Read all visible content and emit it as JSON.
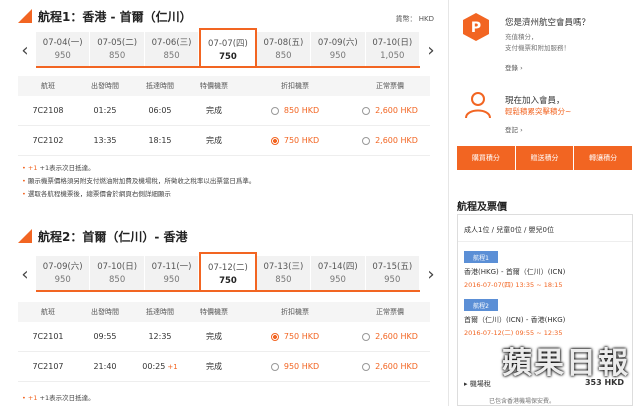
{
  "currency_label": "貨幣： HKD",
  "segments": [
    {
      "title": "航程1：香港 - 首爾（仁川）",
      "dates": [
        {
          "date": "07-04(一)",
          "price": "950"
        },
        {
          "date": "07-05(二)",
          "price": "850"
        },
        {
          "date": "07-06(三)",
          "price": "850"
        },
        {
          "date": "07-07(四)",
          "price": "750",
          "selected": true
        },
        {
          "date": "07-08(五)",
          "price": "850"
        },
        {
          "date": "07-09(六)",
          "price": "950"
        },
        {
          "date": "07-10(日)",
          "price": "1,050"
        }
      ],
      "headers": [
        "航班",
        "出發時間",
        "抵達時間",
        "特價機票",
        "折扣機票",
        "正常票價"
      ],
      "flights": [
        {
          "flight": "7C2108",
          "dep": "01:25",
          "arr": "06:05",
          "plus": "",
          "special": "完成",
          "discount": "850 HKD",
          "normal": "2,600 HKD",
          "discount_selected": false
        },
        {
          "flight": "7C2102",
          "dep": "13:35",
          "arr": "18:15",
          "plus": "",
          "special": "完成",
          "discount": "750 HKD",
          "normal": "2,600 HKD",
          "discount_selected": true
        }
      ],
      "notes": [
        {
          "bullet": "• +1",
          "text": " +1表示次日抵達。"
        },
        {
          "bullet": "•",
          "text": " 顯示機票價格須另附支付燃油附加費及機場稅，所徵收之稅率以出票當日爲準。"
        },
        {
          "bullet": "•",
          "text": " 選取各航程機票後，總票價會於網頁右側詳細顯示"
        }
      ]
    },
    {
      "title": "航程2：首爾（仁川）- 香港",
      "dates": [
        {
          "date": "07-09(六)",
          "price": "950"
        },
        {
          "date": "07-10(日)",
          "price": "850"
        },
        {
          "date": "07-11(一)",
          "price": "950"
        },
        {
          "date": "07-12(二)",
          "price": "750",
          "selected": true
        },
        {
          "date": "07-13(三)",
          "price": "850"
        },
        {
          "date": "07-14(四)",
          "price": "950"
        },
        {
          "date": "07-15(五)",
          "price": "950"
        }
      ],
      "headers": [
        "航班",
        "出發時間",
        "抵達時間",
        "特價機票",
        "折扣機票",
        "正常票價"
      ],
      "flights": [
        {
          "flight": "7C2101",
          "dep": "09:55",
          "arr": "12:35",
          "plus": "",
          "special": "完成",
          "discount": "750 HKD",
          "normal": "2,600 HKD",
          "discount_selected": true
        },
        {
          "flight": "7C2107",
          "dep": "21:40",
          "arr": "00:25",
          "plus": "+1",
          "special": "完成",
          "discount": "950 HKD",
          "normal": "2,600 HKD",
          "discount_selected": false
        }
      ],
      "notes": [
        {
          "bullet": "• +1",
          "text": " +1表示次日抵達。"
        }
      ]
    }
  ],
  "sidebar": {
    "member_title": "您是濟州航空會員嗎？",
    "member_sub1": "充值積分，",
    "member_sub2": "支付機票和附加服務！",
    "login": "登錄 ›",
    "join_title": "現在加入會員，",
    "join_sub": "輕鬆積累突擊積分~",
    "join_link": "登記 ›",
    "tabs": [
      "購買積分",
      "贈送積分",
      "轉讓積分"
    ],
    "summary_title": "航程及票價",
    "pax": "成人1位 / 兒童0位 / 嬰兒0位",
    "seg1_tag": "航程1",
    "seg1_route": "香港(HKG) - 首爾（仁川）(ICN)",
    "seg1_date": "2016-07-07(四) 13:35 ~ 18:15",
    "seg2_tag": "航程2",
    "seg2_route": "首爾（仁川）(ICN) - 香港(HKG)",
    "seg2_date": "2016-07-12(二) 09:55 ~ 12:35",
    "fare_label": "▸ 機場稅",
    "fare_value": "353 HKD",
    "footer": "已包含香港機場保安費。"
  },
  "watermark": "蘋果日報",
  "colors": {
    "accent": "#f26522",
    "tag": "#5b8fd6"
  }
}
